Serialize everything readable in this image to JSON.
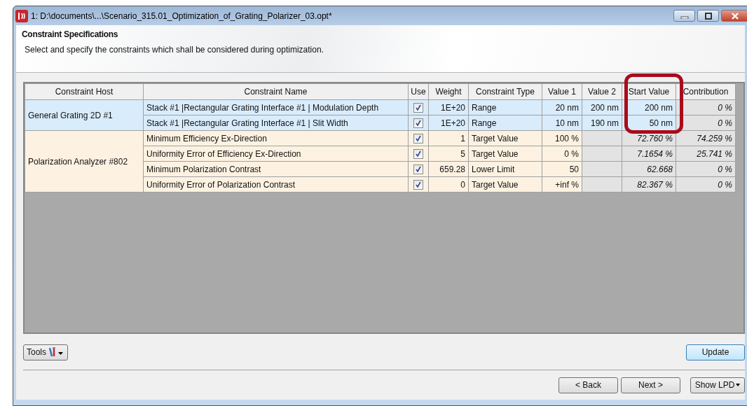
{
  "window": {
    "title": "1: D:\\documents\\...\\Scenario_315.01_Optimization_of_Grating_Polarizer_03.opt*"
  },
  "header": {
    "title": "Constraint Specifications",
    "description": "Select and specify the constraints which shall be considered during optimization."
  },
  "table": {
    "columns": [
      "Constraint Host",
      "Constraint Name",
      "Use",
      "Weight",
      "Constraint Type",
      "Value 1",
      "Value 2",
      "Start Value",
      "Contribution"
    ],
    "groups": [
      {
        "host": "General Grating 2D #1",
        "color": "#d9ecfc",
        "rows": [
          {
            "name": "Stack #1 |Rectangular Grating Interface #1 | Modulation Depth",
            "checked": true,
            "weight": "1E+20",
            "type": "Range",
            "value_1": "20 nm",
            "value_2": "200 nm",
            "start_editable": true,
            "start_value": "200 nm",
            "contribution": "0 %"
          },
          {
            "name": "Stack #1 |Rectangular Grating Interface #1 | Slit Width",
            "checked": true,
            "weight": "1E+20",
            "type": "Range",
            "value_1": "10 nm",
            "value_2": "190 nm",
            "start_editable": true,
            "start_value": "50 nm",
            "contribution": "0 %"
          }
        ]
      },
      {
        "host": "Polarization Analyzer #802",
        "color": "#fdf2e2",
        "rows": [
          {
            "name": "Minimum Efficiency Ex-Direction",
            "checked": true,
            "weight": "1",
            "type": "Target Value",
            "value_1": "100 %",
            "start_editable": false,
            "start_value": "72.760 %",
            "contribution": "74.259 %"
          },
          {
            "name": "Uniformity Error of Efficiency Ex-Direction",
            "checked": true,
            "weight": "5",
            "type": "Target Value",
            "value_1": "0 %",
            "start_editable": false,
            "start_value": "7.1654 %",
            "contribution": "25.741 %"
          },
          {
            "name": "Minimum Polarization Contrast",
            "checked": true,
            "weight": "659.28",
            "type": "Lower Limit",
            "value_1": "50",
            "start_editable": false,
            "start_value": "62.668",
            "contribution": "0 %"
          },
          {
            "name": "Uniformity Error of Polarization Contrast",
            "checked": true,
            "weight": "0",
            "type": "Target Value",
            "value_1": "+inf %",
            "start_editable": false,
            "start_value": "82.367 %",
            "contribution": "0 %"
          }
        ]
      }
    ]
  },
  "buttons": {
    "tools": "Tools",
    "update": "Update",
    "back": "< Back",
    "next": "Next >",
    "show": "Show  LPD"
  }
}
